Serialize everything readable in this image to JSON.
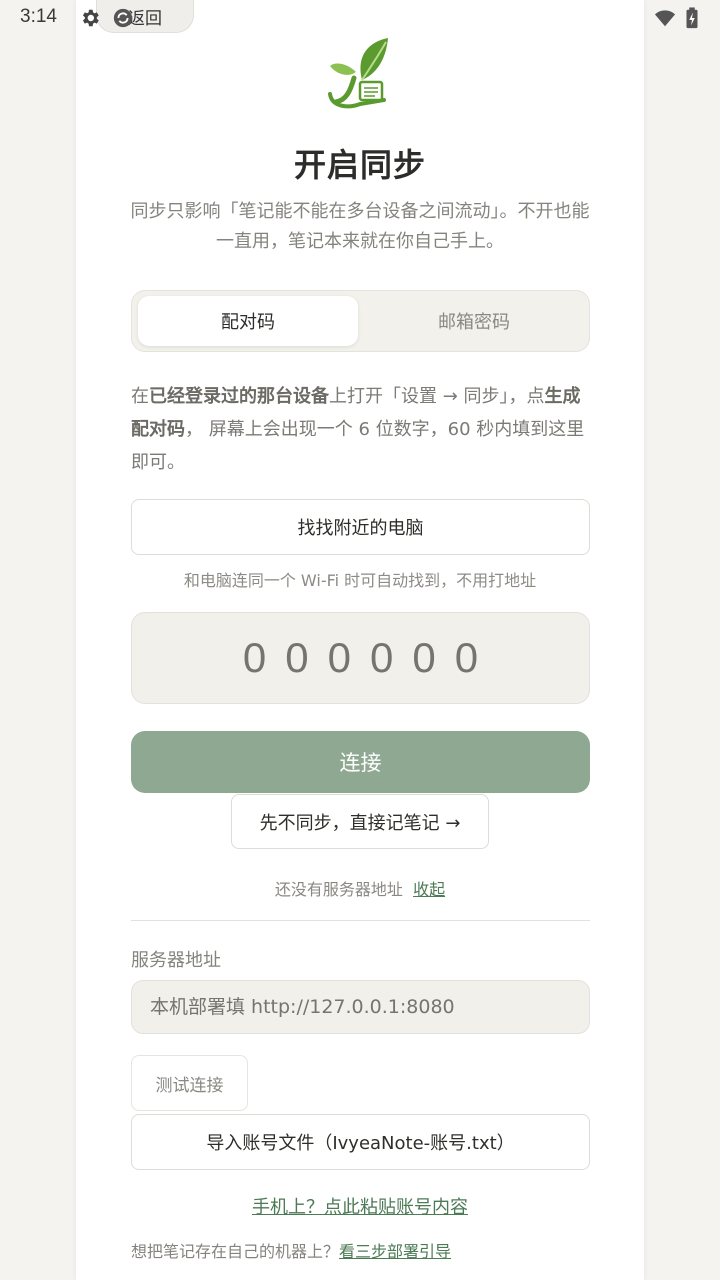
{
  "status_bar": {
    "time": "3:14",
    "icons": [
      "gear-icon",
      "sync-icon",
      "sim-icon",
      "wifi-icon",
      "battery-charging-icon"
    ]
  },
  "nav": {
    "back_label": "返回"
  },
  "header": {
    "title": "开启同步",
    "subtitle": "同步只影响「笔记能不能在多台设备之间流动」。不开也能一直用，笔记本来就在你自己手上。"
  },
  "tabs": [
    {
      "label": "配对码",
      "active": true
    },
    {
      "label": "邮箱密码",
      "active": false
    }
  ],
  "instructions": {
    "t1": "在",
    "b1": "已经登录过的那台设备",
    "t2": "上打开「设置 → 同步」，点",
    "b2": "生成配对码",
    "t3": "， 屏幕上会出现一个 6 位数字，60 秒内填到这里即可。"
  },
  "nearby": {
    "button_label": "找找附近的电脑",
    "hint": "和电脑连同一个 Wi-Fi 时可自动找到，不用打地址"
  },
  "code_input": {
    "placeholder": "000000"
  },
  "connect": {
    "label": "连接"
  },
  "skip": {
    "label": "先不同步，直接记笔记 →"
  },
  "server_toggle": {
    "text": "还没有服务器地址",
    "link": "收起"
  },
  "server": {
    "label": "服务器地址",
    "placeholder": "本机部署填 http://127.0.0.1:8080",
    "test_label": "测试连接",
    "import_label": "导入账号文件（IvyeaNote-账号.txt）"
  },
  "paste_link": "手机上？点此粘贴账号内容",
  "footer": {
    "text": "想把笔记存在自己的机器上？",
    "link": "看三步部署引导"
  },
  "colors": {
    "accent": "#8ea892",
    "link": "#4b7a55",
    "background": "#f4f3ef",
    "logo_green": "#5a9a2e"
  }
}
